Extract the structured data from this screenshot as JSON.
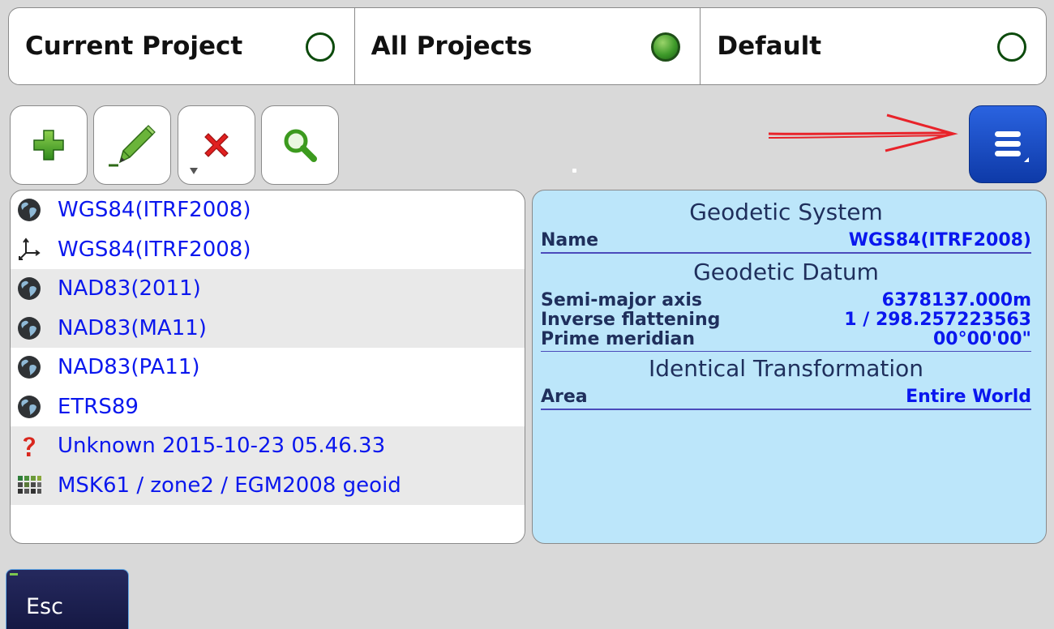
{
  "tabs": [
    {
      "label": "Current Project",
      "selected": false
    },
    {
      "label": "All Projects",
      "selected": true
    },
    {
      "label": "Default",
      "selected": false
    }
  ],
  "toolbar": {
    "buttons": [
      "plus-icon",
      "pencil-icon",
      "delete-x-icon",
      "magnifier-icon"
    ],
    "menu_icon": "menu-lines-icon"
  },
  "annotation": {
    "arrow_color": "#e8232a"
  },
  "list": {
    "items": [
      {
        "icon": "globe-icon",
        "label": "WGS84(ITRF2008)"
      },
      {
        "icon": "axes-icon",
        "label": "WGS84(ITRF2008)"
      },
      {
        "icon": "globe-icon",
        "label": "NAD83(2011)"
      },
      {
        "icon": "globe-icon",
        "label": "NAD83(MA11)"
      },
      {
        "icon": "globe-icon",
        "label": "NAD83(PA11)"
      },
      {
        "icon": "globe-icon",
        "label": "ETRS89"
      },
      {
        "icon": "question-icon",
        "label": "Unknown 2015-10-23 05.46.33"
      },
      {
        "icon": "grid-icon",
        "label": "MSK61 / zone2 / EGM2008 geoid"
      }
    ]
  },
  "info": {
    "geodetic_system": {
      "title": "Geodetic System",
      "name_label": "Name",
      "name_value": "WGS84(ITRF2008)"
    },
    "geodetic_datum": {
      "title": "Geodetic Datum",
      "semi_major_label": "Semi-major axis",
      "semi_major_value": "6378137.000m",
      "inv_flat_label": "Inverse flattening",
      "inv_flat_value": "1 / 298.257223563",
      "prime_meridian_label": "Prime meridian",
      "prime_meridian_value": "00°00'00\""
    },
    "transformation": {
      "title": "Identical Transformation",
      "area_label": "Area",
      "area_value": "Entire World"
    }
  },
  "esc": {
    "label": "Esc"
  },
  "colors": {
    "link_blue": "#0a17ee",
    "panel_blue": "#bce6fa",
    "menu_blue": "#1b4fcf",
    "esc_navy": "#1b1f4e"
  }
}
